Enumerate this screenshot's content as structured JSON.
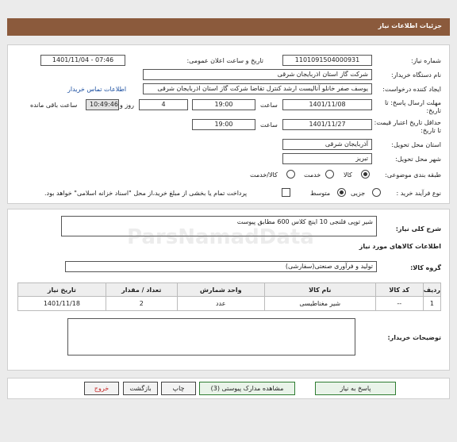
{
  "header": {
    "title": "جزئیات اطلاعات نیاز"
  },
  "form": {
    "need_number_label": "شماره نیاز:",
    "need_number": "1101091504000931",
    "announce_label": "تاریخ و ساعت اعلان عمومی:",
    "announce_value": "1401/11/04 - 07:46",
    "buyer_org_label": "نام دستگاه خریدار:",
    "buyer_org": "شرکت گاز استان اذربایجان شرقی",
    "creator_label": "ایجاد کننده درخواست:",
    "creator": "یوسف صفر خانلو  آنالیست ارشد کنترل تقاضا  شرکت گاز استان اذربایجان شرقی",
    "contact_link": "اطلاعات تماس خریدار",
    "deadline_label": "مهلت ارسال پاسخ: تا تاریخ:",
    "deadline_date": "1401/11/08",
    "time_label": "ساعت",
    "deadline_time": "19:00",
    "days_value": "4",
    "days_label": "روز و",
    "remaining_time": "10:49:46",
    "remaining_label": "ساعت باقی مانده",
    "validity_label": "حداقل تاریخ اعتبار قیمت: تا تاریخ:",
    "validity_date": "1401/11/27",
    "validity_time": "19:00",
    "province_label": "استان محل تحویل:",
    "province": "آذربایجان شرقی",
    "city_label": "شهر محل تحویل:",
    "city": "تبریز",
    "category_label": "طبقه بندی موضوعی:",
    "category_options": [
      "کالا",
      "خدمت",
      "کالا/خدمت"
    ],
    "process_label": "نوع فرآیند خرید :",
    "process_options": [
      "جزیی",
      "متوسط"
    ],
    "payment_note": "پرداخت تمام یا بخشی از مبلغ خرید،از محل \"اسناد خزانه اسلامی\" خواهد بود."
  },
  "details": {
    "summary_label": "شرح کلی نیاز:",
    "summary": "شیر توپی فلنجی 10 اینچ کلاس 600 مطابق پیوست",
    "goods_info_title": "اطلاعات کالاهای مورد نیاز",
    "goods_group_label": "گروه کالا:",
    "goods_group": "تولید و فرآوری صنعتی(سفارشی)",
    "table": {
      "headers": [
        "ردیف",
        "کد کالا",
        "نام کالا",
        "واحد شمارش",
        "تعداد / مقدار",
        "تاریخ نیاز"
      ],
      "rows": [
        [
          "1",
          "--",
          "شیر مغناطیسی",
          "عدد",
          "2",
          "1401/11/18"
        ]
      ]
    },
    "buyer_notes_label": "توضیحات خریدار:",
    "buyer_notes": ""
  },
  "actions": {
    "reply": "پاسخ به نیاز",
    "view_docs": "مشاهده مدارک پیوستی (3)",
    "print": "چاپ",
    "back": "بازگشت",
    "exit": "خروج"
  },
  "watermark": "ParsNamadData"
}
